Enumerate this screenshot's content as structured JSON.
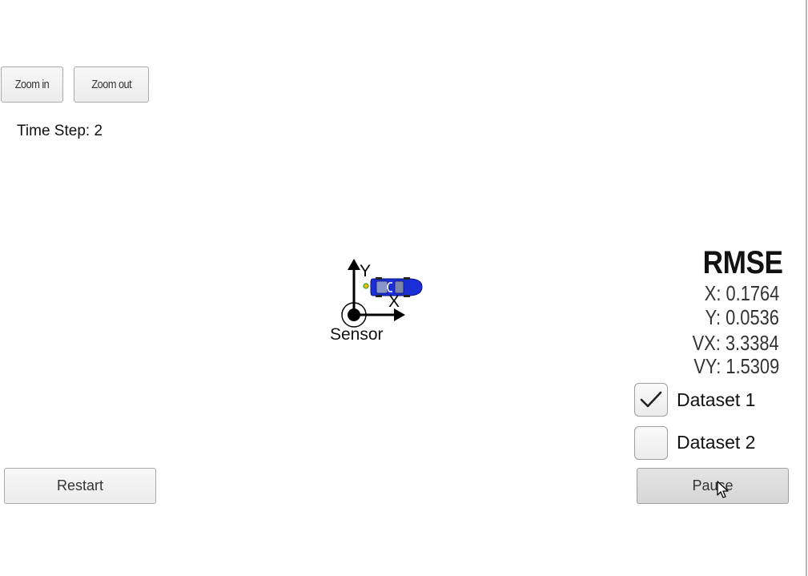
{
  "toolbar": {
    "zoom_in_label": "Zoom in",
    "zoom_out_label": "Zoom out"
  },
  "status": {
    "time_step": "Time Step: 2"
  },
  "scene": {
    "axis_y_label": "Y",
    "axis_x_label": "X",
    "sensor_label": "Sensor",
    "car_color": "#1a2fd6"
  },
  "rmse": {
    "title": "RMSE",
    "x": "X: 0.1764",
    "y": "Y: 0.0536",
    "vx": "VX: 3.3384",
    "vy": "VY: 1.5309"
  },
  "datasets": [
    {
      "label": "Dataset 1",
      "checked": true
    },
    {
      "label": "Dataset 2",
      "checked": false
    }
  ],
  "controls": {
    "restart_label": "Restart",
    "pause_label": "Pause"
  }
}
